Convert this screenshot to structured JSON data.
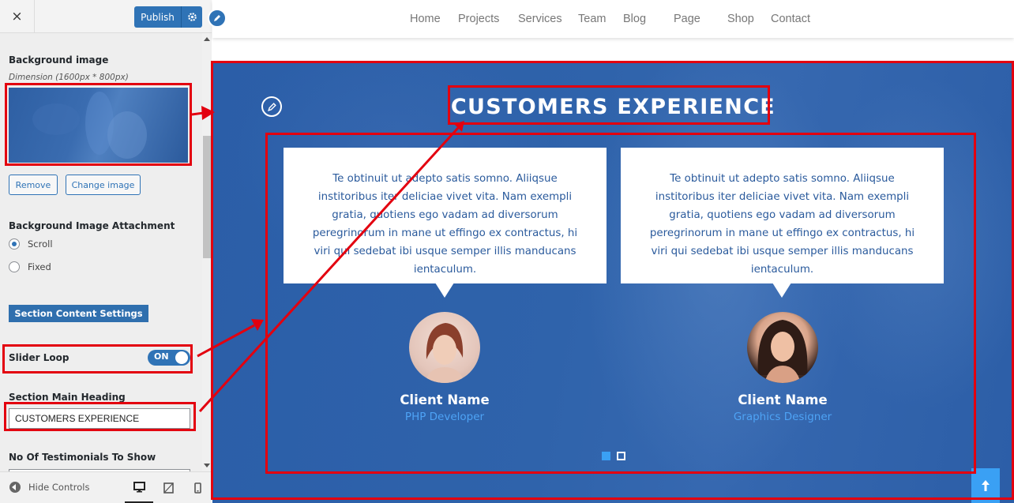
{
  "sidebar": {
    "close_label": "×",
    "publish_label": "Publish",
    "background_image": {
      "title": "Background image",
      "dimension": "Dimension (1600px * 800px)",
      "remove_label": "Remove",
      "change_label": "Change image"
    },
    "attachment": {
      "title": "Background Image Attachment",
      "options": [
        "Scroll",
        "Fixed"
      ],
      "selected": "Scroll"
    },
    "section_content_settings_label": "Section Content Settings",
    "slider_loop": {
      "label": "Slider Loop",
      "state": "ON"
    },
    "section_main_heading": {
      "label": "Section Main Heading",
      "value": "CUSTOMERS EXPERIENCE"
    },
    "testimonials_to_show": {
      "label": "No Of Testimonials To Show"
    },
    "footer": {
      "hide_controls_label": "Hide Controls"
    }
  },
  "nav": {
    "items": [
      "Home",
      "Projects",
      "Services",
      "Team",
      "Blog",
      "Page",
      "Shop",
      "Contact"
    ]
  },
  "section": {
    "heading": "CUSTOMERS EXPERIENCE",
    "testimonials": [
      {
        "text": "Te obtinuit ut adepto satis somno. Aliiqsue institoribus iter deliciae vivet vita. Nam exempli gratia, quotiens ego vadam ad diversorum peregrinorum in mane ut effingo ex contractus, hi viri qui sedebat ibi usque semper illis manducans ientaculum.",
        "name": "Client Name",
        "role": "PHP Developer"
      },
      {
        "text": "Te obtinuit ut adepto satis somno. Aliiqsue institoribus iter deliciae vivet vita. Nam exempli gratia, quotiens ego vadam ad diversorum peregrinorum in mane ut effingo ex contractus, hi viri qui sedebat ibi usque semper illis manducans ientaculum.",
        "name": "Client Name",
        "role": "Graphics Designer"
      }
    ],
    "slider_pages": 2,
    "active_slide": 1
  },
  "colors": {
    "accent": "#2f73b6",
    "section_bg": "#2f63ab",
    "highlight": "#e3000f",
    "role_text": "#4ea3f5"
  }
}
